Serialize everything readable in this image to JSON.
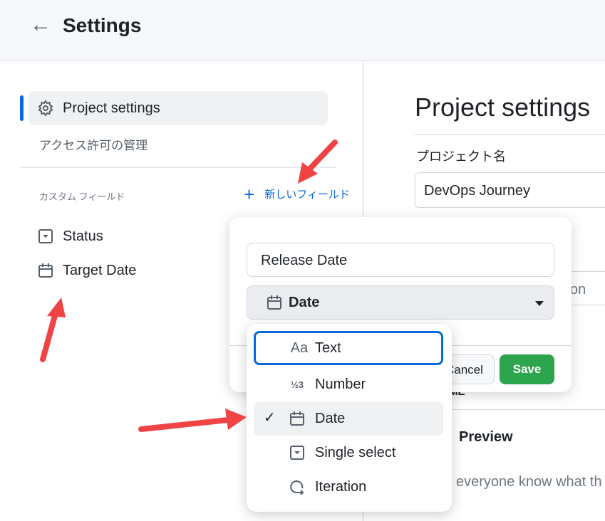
{
  "header": {
    "title": "Settings",
    "back_icon": "arrow-left-icon"
  },
  "sidebar": {
    "items": [
      {
        "label": "Project settings",
        "icon": "gear-icon",
        "active": true
      },
      {
        "label": "アクセス許可の管理"
      }
    ],
    "custom_fields_label": "カスタム フィールド",
    "new_field_label": "新しいフィールド",
    "fields": [
      {
        "label": "Status",
        "icon": "single-select-icon"
      },
      {
        "label": "Target Date",
        "icon": "calendar-icon"
      }
    ]
  },
  "main": {
    "title": "Project settings",
    "name_label": "プロジェクト名",
    "name_value": "DevOps Journey",
    "frag1": "on",
    "frag2": "ME",
    "preview": "Preview",
    "desc_frag": "everyone know what th"
  },
  "popup": {
    "name_value": "Release Date",
    "type_value": "Date",
    "cancel": "Cancel",
    "save": "Save",
    "save_color": "#2da44e"
  },
  "menu": {
    "options": [
      {
        "label": "Text",
        "icon": "text-icon",
        "focused": true
      },
      {
        "label": "Number",
        "icon": "number-icon"
      },
      {
        "label": "Date",
        "icon": "calendar-icon",
        "selected": true
      },
      {
        "label": "Single select",
        "icon": "single-select-icon"
      },
      {
        "label": "Iteration",
        "icon": "iteration-icon"
      }
    ]
  },
  "annotation_color": "#f04343"
}
